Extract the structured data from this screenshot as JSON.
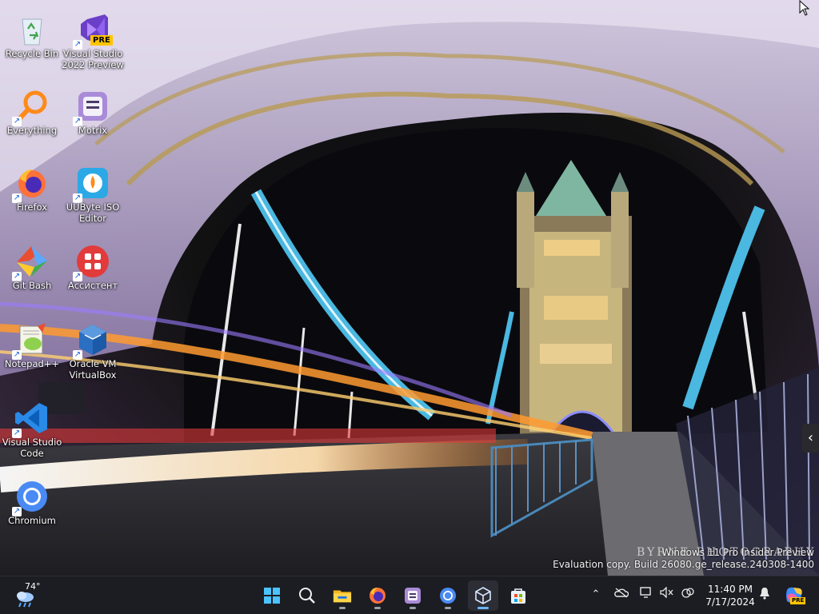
{
  "desktop": {
    "icons": [
      {
        "label": "Recycle Bin",
        "icon": "recycle-bin-icon"
      },
      {
        "label": "Visual Studio 2022 Preview",
        "icon": "visual-studio-preview-icon",
        "badge": "PRE"
      },
      {
        "label": "Everything",
        "icon": "everything-search-icon"
      },
      {
        "label": "Motrix",
        "icon": "motrix-icon"
      },
      {
        "label": "Firefox",
        "icon": "firefox-icon"
      },
      {
        "label": "UUByte ISO Editor",
        "icon": "uubyte-iso-editor-icon"
      },
      {
        "label": "Git Bash",
        "icon": "git-bash-icon"
      },
      {
        "label": "Ассистент",
        "icon": "assistant-icon"
      },
      {
        "label": "Notepad++",
        "icon": "notepadpp-icon"
      },
      {
        "label": "Oracle VM VirtualBox",
        "icon": "virtualbox-icon"
      },
      {
        "label": "Visual Studio Code",
        "icon": "vscode-icon"
      },
      {
        "label": "Chromium",
        "icon": "chromium-icon"
      }
    ],
    "watermark": {
      "line1": "Windows 11 Pro Insider Preview",
      "line2": "Evaluation copy. Build 26080.ge_release.240308-1400"
    },
    "photo_credit": "BYRNE PHOTOGRAPHY"
  },
  "taskbar": {
    "weather": {
      "temp": "74°",
      "icon": "weather-rain-icon"
    },
    "apps": [
      {
        "name": "start",
        "icon": "windows-start-icon"
      },
      {
        "name": "search",
        "icon": "search-icon"
      },
      {
        "name": "file-explorer",
        "icon": "folder-icon"
      },
      {
        "name": "firefox",
        "icon": "firefox-icon"
      },
      {
        "name": "motrix",
        "icon": "motrix-icon"
      },
      {
        "name": "chromium",
        "icon": "chromium-icon"
      },
      {
        "name": "virtualbox",
        "icon": "virtualbox-icon"
      },
      {
        "name": "store",
        "icon": "store-icon"
      }
    ],
    "tray": [
      "chevron-up-icon",
      "onedrive-icon",
      "network-icon",
      "volume-muted-icon",
      "security-icon"
    ],
    "clock": {
      "time": "11:40 PM",
      "date": "7/17/2024"
    },
    "notification_icon": "bell-icon",
    "copilot_badge": "PRE"
  },
  "colors": {
    "taskbar": "#1c1d22",
    "accent": "#6cb6ff"
  }
}
